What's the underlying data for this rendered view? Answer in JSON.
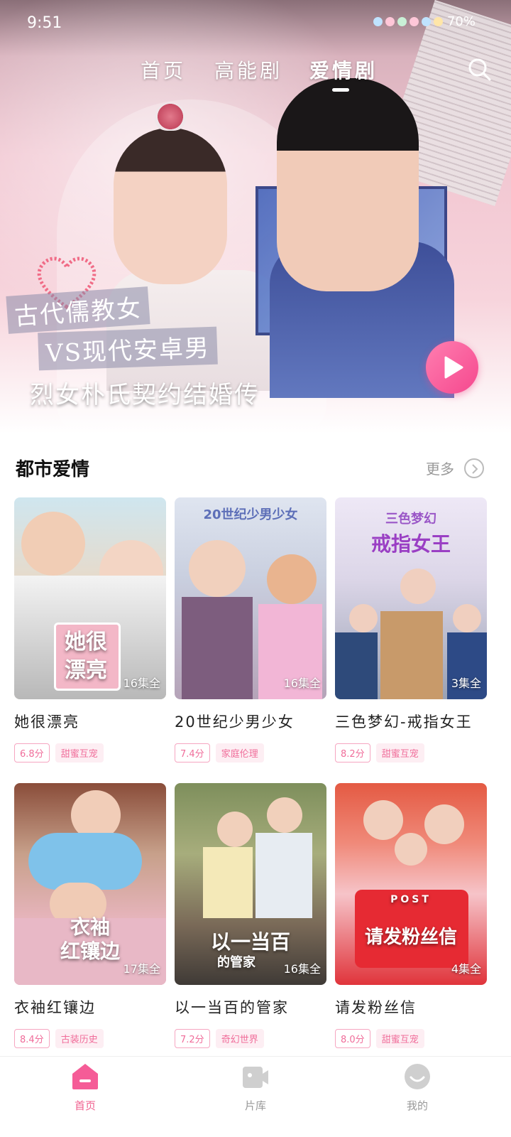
{
  "status_bar": {
    "time": "9:51",
    "battery": "70%"
  },
  "top_tabs": [
    {
      "label": "首页"
    },
    {
      "label": "高能剧"
    },
    {
      "label": "爱情剧",
      "active": true
    }
  ],
  "hero": {
    "slogan_line1": "古代儒教女",
    "slogan_line2": "VS现代安卓男",
    "title": "烈女朴氏契约结婚传"
  },
  "section": {
    "title": "都市爱情",
    "more_label": "更多"
  },
  "dramas": [
    {
      "title": "她很漂亮",
      "poster_text": "她很\n漂亮",
      "episodes": "16集全",
      "score": "6.8分",
      "genre": "甜蜜互宠"
    },
    {
      "title": "20世纪少男少女",
      "poster_text": "20世纪少男少女",
      "episodes": "16集全",
      "score": "7.4分",
      "genre": "家庭伦理"
    },
    {
      "title": "三色梦幻-戒指女王",
      "poster_text_small": "三色梦幻",
      "poster_text": "戒指女王",
      "episodes": "3集全",
      "score": "8.2分",
      "genre": "甜蜜互宠"
    },
    {
      "title": "衣袖红镶边",
      "poster_text": "衣袖\n红镶边",
      "episodes": "17集全",
      "score": "8.4分",
      "genre": "古装历史"
    },
    {
      "title": "以一当百的管家",
      "poster_text": "以一当百",
      "poster_text_small": "的管家",
      "episodes": "16集全",
      "score": "7.2分",
      "genre": "奇幻世界"
    },
    {
      "title": "请发粉丝信",
      "poster_text_small": "POST",
      "poster_text": "请发粉丝信",
      "episodes": "4集全",
      "score": "8.0分",
      "genre": "甜蜜互宠"
    }
  ],
  "bottom_nav": [
    {
      "label": "首页",
      "icon": "home-icon",
      "active": true
    },
    {
      "label": "片库",
      "icon": "video-library-icon"
    },
    {
      "label": "我的",
      "icon": "profile-icon"
    }
  ],
  "colors": {
    "accent": "#f0608f",
    "tag_text": "#f06d9a",
    "tag_bg": "#fdeef3"
  }
}
